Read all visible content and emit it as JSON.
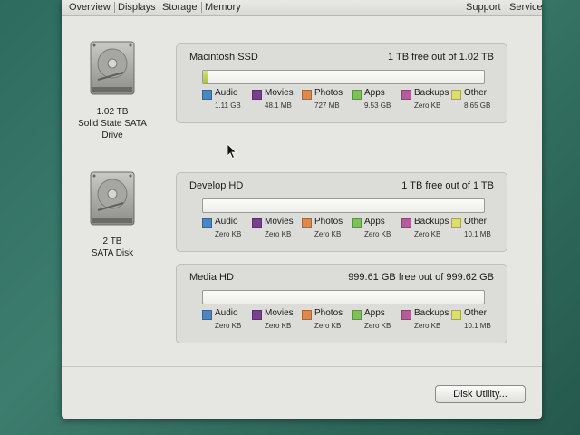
{
  "tabs": [
    "Overview",
    "Displays",
    "Storage",
    "Memory"
  ],
  "toolbar_right": [
    "Support",
    "Service"
  ],
  "drives": [
    {
      "size": "1.02 TB",
      "type_line1": "Solid State SATA",
      "type_line2": "Drive"
    },
    {
      "size": "2 TB",
      "type_line1": "SATA Disk",
      "type_line2": ""
    }
  ],
  "volumes": [
    {
      "name": "Macintosh SSD",
      "free": "1 TB free out of 1.02 TB",
      "used_fraction": 0.02,
      "legend": [
        {
          "label": "Audio",
          "size": "1.11 GB"
        },
        {
          "label": "Movies",
          "size": "48.1 MB"
        },
        {
          "label": "Photos",
          "size": "727 MB"
        },
        {
          "label": "Apps",
          "size": "9.53 GB"
        },
        {
          "label": "Backups",
          "size": "Zero KB"
        },
        {
          "label": "Other",
          "size": "8.65 GB"
        }
      ]
    },
    {
      "name": "Develop HD",
      "free": "1 TB free out of 1 TB",
      "used_fraction": 0,
      "legend": [
        {
          "label": "Audio",
          "size": "Zero KB"
        },
        {
          "label": "Movies",
          "size": "Zero KB"
        },
        {
          "label": "Photos",
          "size": "Zero KB"
        },
        {
          "label": "Apps",
          "size": "Zero KB"
        },
        {
          "label": "Backups",
          "size": "Zero KB"
        },
        {
          "label": "Other",
          "size": "10.1 MB"
        }
      ]
    },
    {
      "name": "Media HD",
      "free": "999.61 GB free out of 999.62 GB",
      "used_fraction": 0,
      "legend": [
        {
          "label": "Audio",
          "size": "Zero KB"
        },
        {
          "label": "Movies",
          "size": "Zero KB"
        },
        {
          "label": "Photos",
          "size": "Zero KB"
        },
        {
          "label": "Apps",
          "size": "Zero KB"
        },
        {
          "label": "Backups",
          "size": "Zero KB"
        },
        {
          "label": "Other",
          "size": "10.1 MB"
        }
      ]
    }
  ],
  "legend_colors": {
    "Audio": "#4a86c6",
    "Movies": "#7a3f8f",
    "Photos": "#e0884a",
    "Apps": "#7cc257",
    "Backups": "#b85b9c",
    "Other": "#dede6a"
  },
  "disk_utility_label": "Disk Utility..."
}
